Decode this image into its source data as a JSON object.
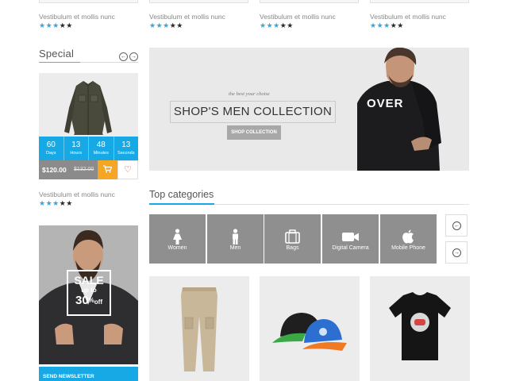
{
  "top_products": [
    {
      "name": "Vestibulum et mollis nunc",
      "rating": 3,
      "max_rating": 5
    },
    {
      "name": "Vestibulum et mollis nunc",
      "rating": 3,
      "max_rating": 5
    },
    {
      "name": "Vestibulum et mollis nunc",
      "rating": 3,
      "max_rating": 5
    },
    {
      "name": "Vestibulum et mollis nunc",
      "rating": 3,
      "max_rating": 5
    }
  ],
  "special": {
    "title": "Special",
    "prev_icon": "arrow-left-icon",
    "next_icon": "arrow-right-icon",
    "countdown": [
      {
        "value": "60",
        "label": "Days"
      },
      {
        "value": "13",
        "label": "Hours"
      },
      {
        "value": "48",
        "label": "Minutes"
      },
      {
        "value": "13",
        "label": "Seconds"
      }
    ],
    "price_new": "$120.00",
    "price_old": "$132.00",
    "cart_icon": "cart-icon",
    "wishlist_icon": "heart-icon",
    "product_name": "Vestibulum et mollis nunc",
    "rating": 3
  },
  "sale_banner": {
    "line1": "SALE",
    "line2": "up to",
    "line3": "30",
    "percent": "%",
    "off": "off"
  },
  "newsletter": {
    "label": "SEND NEWSLETTER"
  },
  "hero": {
    "subtitle": "the best your choise",
    "title": "SHOP'S MEN COLLECTION",
    "button": "SHOP COLLECTION",
    "shirt_text": "OVER"
  },
  "top_categories": {
    "title": "Top categories",
    "items": [
      {
        "label": "Women",
        "icon": "female-icon"
      },
      {
        "label": "Men",
        "icon": "male-icon"
      },
      {
        "label": "Bags",
        "icon": "bag-icon"
      },
      {
        "label": "Digital Camera",
        "icon": "video-camera-icon"
      },
      {
        "label": "Mobile Phone",
        "icon": "apple-icon"
      }
    ],
    "nav_prev_icon": "arrow-left-icon",
    "nav_next_icon": "arrow-right-icon"
  },
  "colors": {
    "accent": "#17a9e6",
    "cart": "#f5a623",
    "wishlist": "#e8313b",
    "star_on": "#2fa8e0",
    "star_off": "#2a2a2a"
  }
}
